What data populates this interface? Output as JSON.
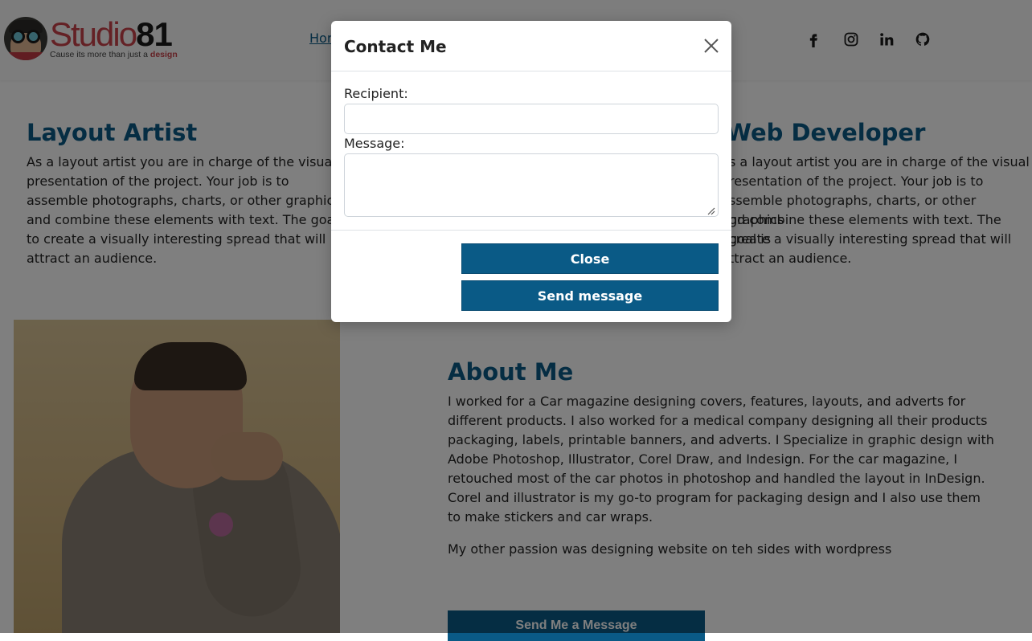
{
  "header": {
    "logo": {
      "word": "Studio",
      "number": "81",
      "tagline": "Cause its more than just a",
      "tagline_accent": "design"
    },
    "nav_link": "Hor",
    "social": [
      "facebook-icon",
      "instagram-icon",
      "linkedin-icon",
      "github-icon"
    ]
  },
  "sections": {
    "layout_artist": {
      "title": "Layout Artist",
      "lines": [
        "As a layout artist you are in charge of the visual",
        "presentation of the project. Your job is to",
        "assemble photographs, charts, or other graphics",
        "and combine these elements with text. The goal is",
        "to create a visually interesting spread that will",
        "attract an audience."
      ]
    },
    "web_developer": {
      "title": "Web Developer",
      "lines": [
        "s a layout artist you are in charge of the visual",
        "resentation of the project. Your job is to",
        "ssemble photographs, charts, or other graphics",
        "nd combine these elements with text. The goal is",
        " create a visually interesting spread that will",
        "ttract an audience."
      ]
    },
    "about": {
      "title": "About Me",
      "lines": [
        "I worked for a Car magazine designing covers, features, layouts, and adverts for",
        "different products. I also worked for a medical company designing all their products",
        "packaging, labels, printable banners, and adverts. I Specialize in graphic design with",
        "Adobe Photoshop, Illustrator, Corel Draw, and Indesign. For the car magazine, I",
        "retouched most of the car photos in photoshop and handled the layout in InDesign.",
        "Corel and illustrator is my go-to program for packaging design and I also use them",
        "to make stickers and car wraps."
      ],
      "extra": "My other passion was designing website on teh sides with wordpress",
      "cta": "Send Me a Message"
    }
  },
  "modal": {
    "title": "Contact Me",
    "recipient_label": "Recipient:",
    "recipient_value": "",
    "message_label": "Message:",
    "message_value": "",
    "close_button": "Close",
    "send_button": "Send message"
  },
  "colors": {
    "accent": "#0a5a86",
    "brand_red": "#c9424a",
    "overlay": "rgba(0,0,0,0.5)"
  }
}
